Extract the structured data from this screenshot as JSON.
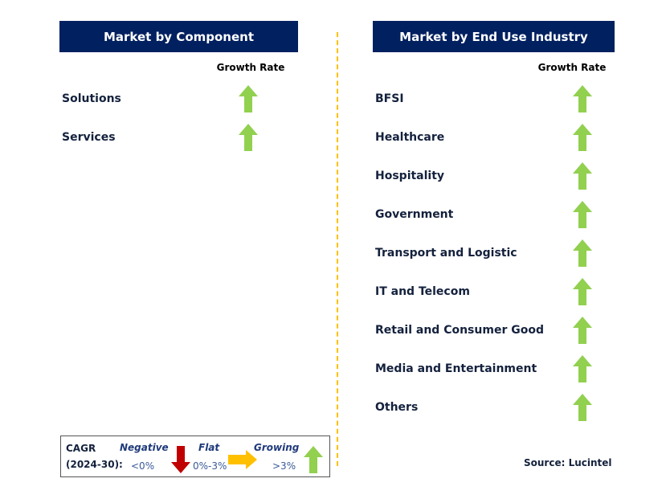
{
  "left": {
    "title": "Market by Component",
    "growth_label": "Growth Rate",
    "items": [
      {
        "label": "Solutions",
        "trend": "growing"
      },
      {
        "label": "Services",
        "trend": "growing"
      }
    ]
  },
  "right": {
    "title": "Market by End Use Industry",
    "growth_label": "Growth Rate",
    "items": [
      {
        "label": "BFSI",
        "trend": "growing"
      },
      {
        "label": "Healthcare",
        "trend": "growing"
      },
      {
        "label": "Hospitality",
        "trend": "growing"
      },
      {
        "label": "Government",
        "trend": "growing"
      },
      {
        "label": "Transport and Logistic",
        "trend": "growing"
      },
      {
        "label": "IT and Telecom",
        "trend": "growing"
      },
      {
        "label": "Retail and Consumer Good",
        "trend": "growing"
      },
      {
        "label": "Media and Entertainment",
        "trend": "growing"
      },
      {
        "label": "Others",
        "trend": "growing"
      }
    ]
  },
  "legend": {
    "cagr": "CAGR",
    "period": "(2024-30):",
    "negative": "Negative",
    "negative_range": "<0%",
    "flat": "Flat",
    "flat_range": "0%-3%",
    "growing": "Growing",
    "growing_range": ">3%"
  },
  "source": "Source: Lucintel",
  "colors": {
    "header": "#002060",
    "growing": "#92D050",
    "flat": "#FFC000",
    "negative": "#C00000",
    "divider": "#FFC000"
  }
}
